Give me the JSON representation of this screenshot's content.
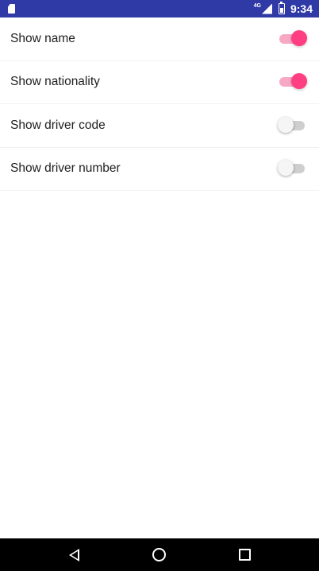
{
  "status_bar": {
    "network_label": "4G",
    "time": "9:34",
    "background": "#2f3aa6",
    "icons": [
      "sim-card-icon",
      "signal-icon",
      "battery-icon"
    ]
  },
  "settings": [
    {
      "label": "Show name",
      "enabled": true
    },
    {
      "label": "Show nationality",
      "enabled": true
    },
    {
      "label": "Show driver code",
      "enabled": false
    },
    {
      "label": "Show driver number",
      "enabled": false
    }
  ],
  "colors": {
    "accent": "#ff3f81",
    "accent_track": "#f7a8c4",
    "switch_off_track": "#bdbdbd"
  },
  "nav_bar": {
    "icons": [
      "back-icon",
      "home-icon",
      "recents-icon"
    ]
  }
}
